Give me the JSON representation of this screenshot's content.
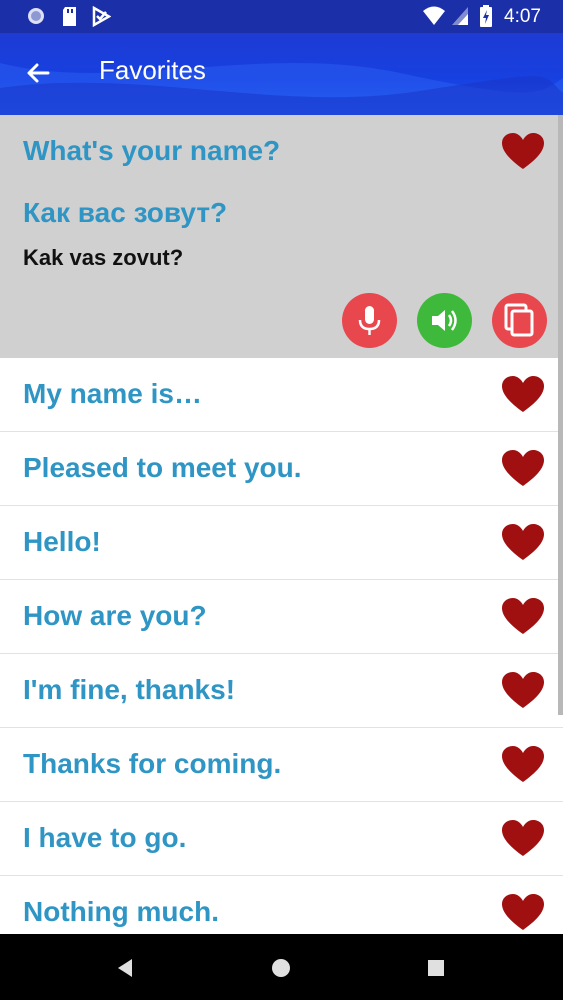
{
  "status_bar": {
    "time": "4:07",
    "left_icons": [
      "notification-dot-icon",
      "sd-card-icon",
      "play-store-icon"
    ],
    "right_icons": [
      "wifi-icon",
      "signal-icon",
      "battery-charging-icon"
    ]
  },
  "app_bar": {
    "title": "Favorites",
    "back_icon": "arrow-back-icon",
    "color": "#1e3bd4"
  },
  "expanded_item": {
    "phrase": "What's your name?",
    "translation": "Как вас зовут?",
    "transliteration": "Kak vas zovut?",
    "background": "#d0d0d0",
    "actions": [
      {
        "icon": "microphone-icon",
        "color": "#e8474e"
      },
      {
        "icon": "speaker-icon",
        "color": "#3fb93b"
      },
      {
        "icon": "copy-icon",
        "color": "#e8474e"
      }
    ]
  },
  "list": {
    "items": [
      {
        "phrase": "My name is…"
      },
      {
        "phrase": "Pleased to meet you."
      },
      {
        "phrase": "Hello!"
      },
      {
        "phrase": "How are you?"
      },
      {
        "phrase": "I'm fine, thanks!"
      },
      {
        "phrase": "Thanks for coming."
      },
      {
        "phrase": "I have to go."
      },
      {
        "phrase": "Nothing much."
      }
    ],
    "heart_color": "#a01010",
    "phrase_color": "#2e95c4"
  },
  "nav_bar": {
    "buttons": [
      "back-triangle-icon",
      "home-circle-icon",
      "recents-square-icon"
    ]
  }
}
